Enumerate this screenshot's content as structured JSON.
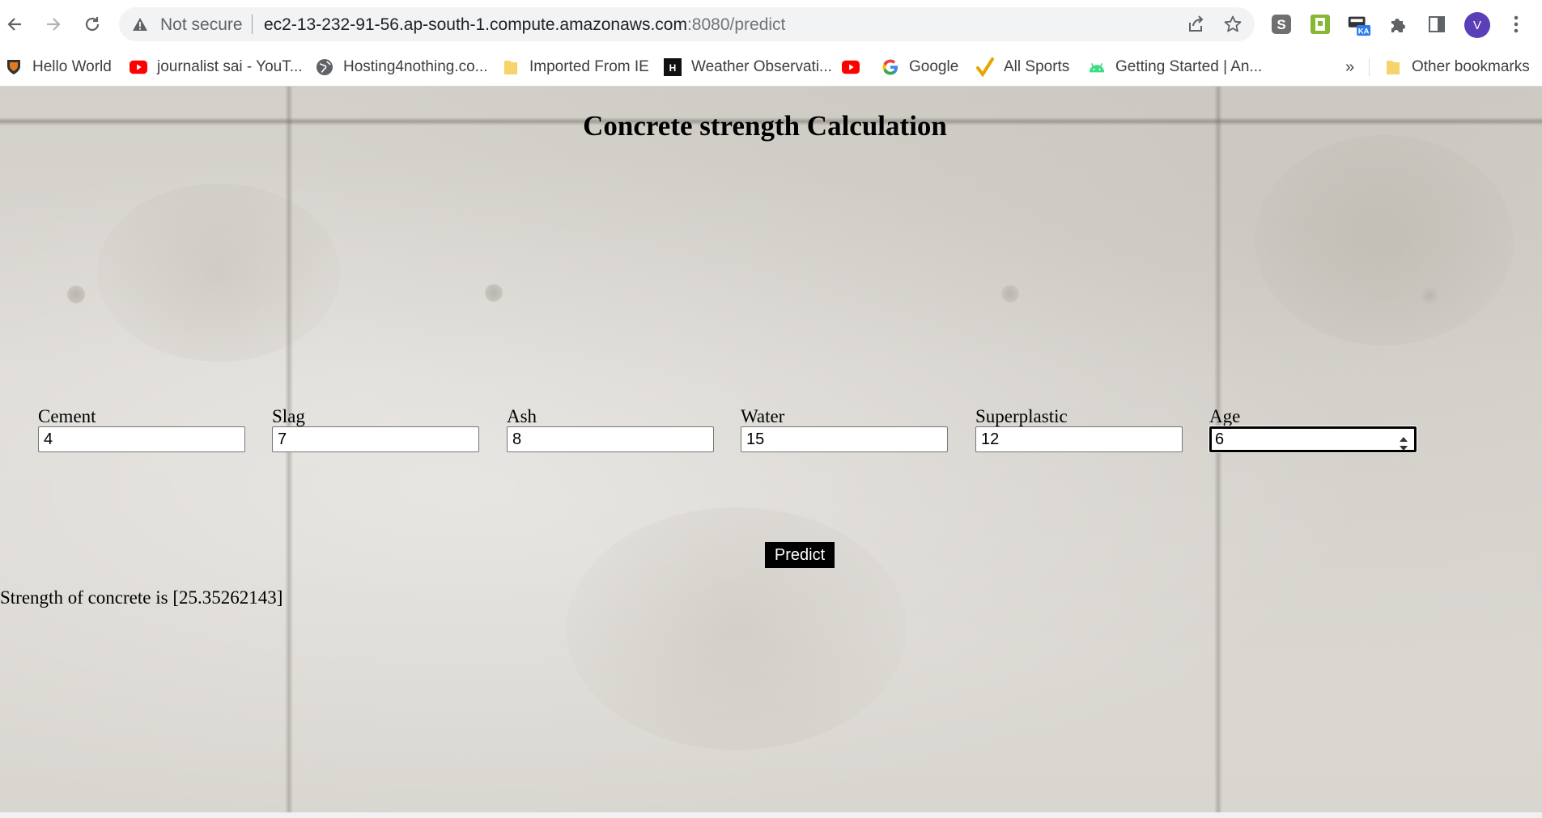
{
  "browser": {
    "security_label": "Not secure",
    "url_host": "ec2-13-232-91-56.ap-south-1.compute.amazonaws.com",
    "url_path": ":8080/predict",
    "avatar_letter": "V",
    "extension_badge": "KA",
    "overflow_chevron": "»"
  },
  "bookmarks": [
    {
      "label": "Hello World",
      "icon": "shield-crest-icon"
    },
    {
      "label": "journalist sai - YouT...",
      "icon": "youtube-icon"
    },
    {
      "label": "Hosting4nothing.co...",
      "icon": "globe-icon"
    },
    {
      "label": "Imported From IE",
      "icon": "folder-icon"
    },
    {
      "label": "Weather Observati...",
      "icon": "hackerrank-icon"
    },
    {
      "label": "",
      "icon": "youtube-icon"
    },
    {
      "label": "Google",
      "icon": "google-icon"
    },
    {
      "label": "All Sports",
      "icon": "checkmark-icon"
    },
    {
      "label": "Getting Started | An...",
      "icon": "android-icon"
    }
  ],
  "other_bookmarks": {
    "label": "Other bookmarks",
    "icon": "folder-icon"
  },
  "page": {
    "title": "Concrete strength Calculation",
    "fields": [
      {
        "label": "Cement",
        "value": "4"
      },
      {
        "label": "Slag",
        "value": "7"
      },
      {
        "label": "Ash",
        "value": "8"
      },
      {
        "label": "Water",
        "value": "15"
      },
      {
        "label": "Superplastic",
        "value": "12"
      },
      {
        "label": "Age",
        "value": "6",
        "focused": true
      }
    ],
    "predict_label": "Predict",
    "result_text": "Strength of concrete is [25.35262143]"
  },
  "colors": {
    "button_bg": "#000000",
    "button_text": "#ffffff",
    "avatar": "#5b3fb8",
    "youtube_red": "#ff0000",
    "folder_yellow": "#f6d36b"
  }
}
